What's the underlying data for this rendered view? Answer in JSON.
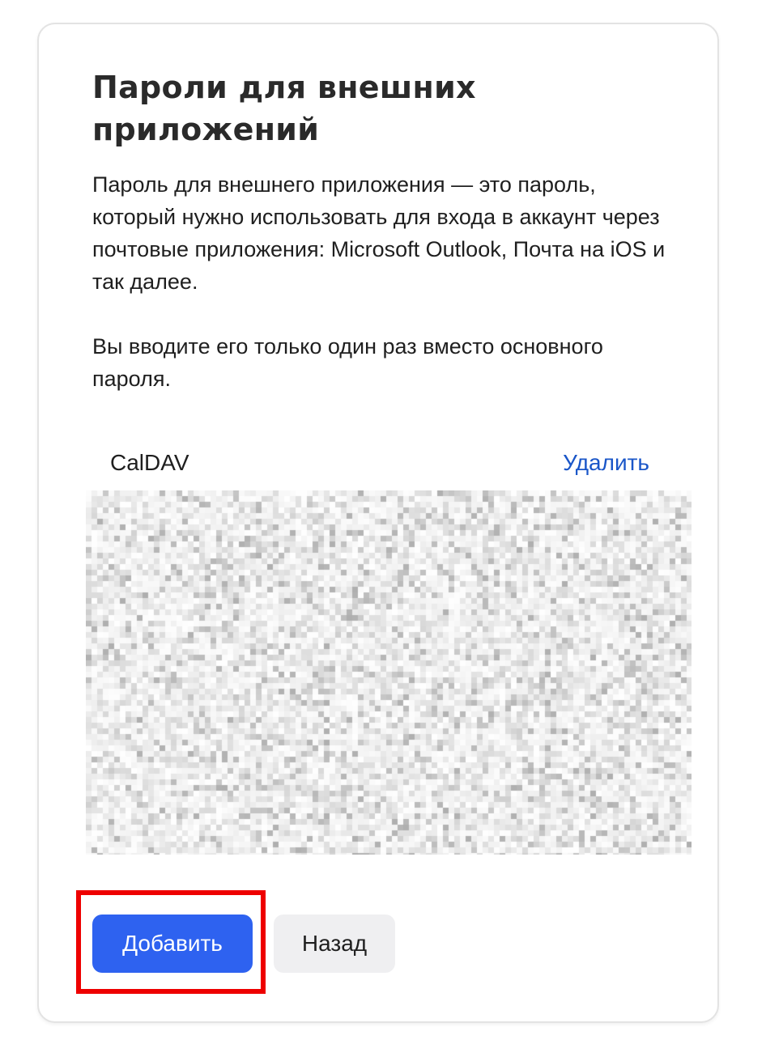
{
  "card": {
    "title": "Пароли для внешних приложений",
    "description": "Пароль для внешнего приложения — это пароль, который нужно использовать для входа в аккаунт через почтовые приложения: Microsoft Outlook, Почта на iOS и так далее.",
    "note": "Вы вводите его только один раз вместо основного пароля."
  },
  "app_password": {
    "app_name": "CalDAV",
    "delete_label": "Удалить"
  },
  "actions": {
    "add_label": "Добавить",
    "back_label": "Назад"
  },
  "colors": {
    "primary": "#2e62f0",
    "link": "#1a56c8",
    "highlight": "#ee0000",
    "secondary_button": "#efeff1"
  }
}
